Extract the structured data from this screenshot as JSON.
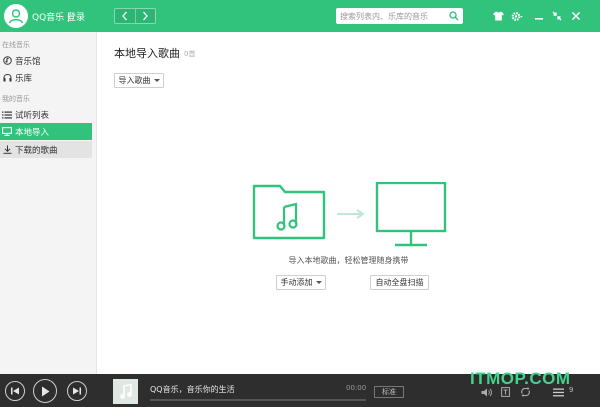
{
  "app": {
    "name": "QQ音乐 |",
    "login": "登录"
  },
  "search": {
    "placeholder": "搜索列表内、乐库的音乐"
  },
  "colors": {
    "accent": "#31c27c",
    "player_bg": "#2e2e2e",
    "sidebar_bg": "#f4f4f4"
  },
  "icons": {
    "titlebar": [
      "skin-icon",
      "settings-icon",
      "minimize-icon",
      "shrink-icon",
      "close-icon"
    ],
    "player_right": [
      "volume-icon",
      "lyrics-icon",
      "loop-icon",
      "playlist-icon"
    ]
  },
  "sidebar": {
    "online_heading": "在线音乐",
    "my_heading": "我的音乐",
    "items": [
      {
        "label": "音乐馆",
        "icon": "music-hall-icon"
      },
      {
        "label": "乐库",
        "icon": "headphones-icon"
      },
      {
        "label": "试听列表",
        "icon": "list-icon"
      },
      {
        "label": "本地导入",
        "icon": "monitor-icon"
      },
      {
        "label": "下载的歌曲",
        "icon": "download-icon"
      }
    ]
  },
  "main": {
    "title": "本地导入歌曲",
    "count": "0首",
    "import_button": "导入歌曲",
    "description": "导入本地歌曲，轻松管理随身携带",
    "manual_add_button": "手动添加",
    "auto_scan_button": "自动全盘扫描"
  },
  "player": {
    "song": "QQ音乐，音乐你的生活",
    "time": "00:00",
    "quality": "标准",
    "progress": 0,
    "playlist_count": "9"
  },
  "watermark": "ITMOP.COM"
}
